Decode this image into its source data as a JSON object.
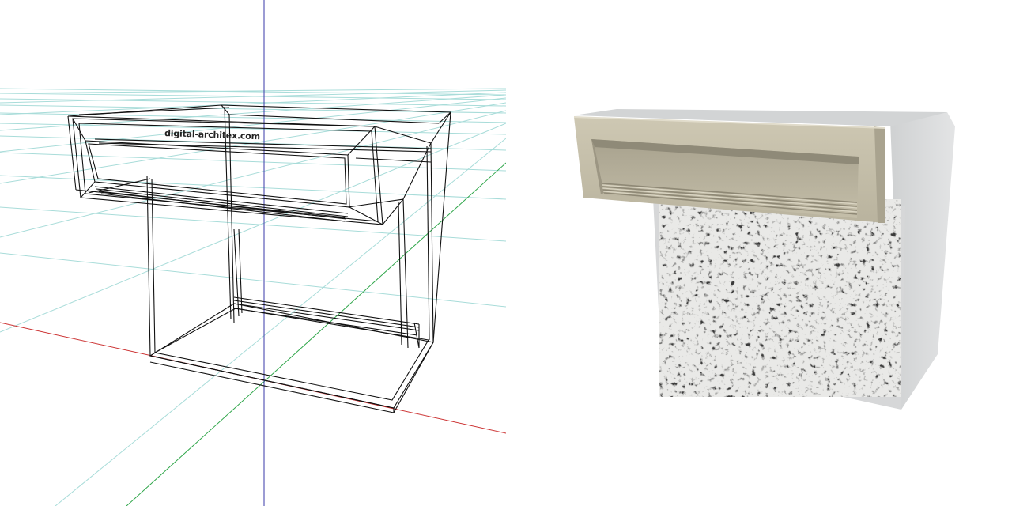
{
  "watermark": "digital-architex.com",
  "colors": {
    "grid": "#9fd9d6",
    "axis_x": "#cc3333",
    "axis_y": "#33aa33",
    "axis_z": "#3333aa",
    "wire": "#111111",
    "frame": "#c8c2ae",
    "frame_dark": "#a9a38f",
    "body": "#d9dadb",
    "body_side": "#c7c9ca",
    "granite_light": "#e8e8e6",
    "granite_dark": "#555555"
  },
  "views": [
    "wireframe-view",
    "rendered-view"
  ]
}
